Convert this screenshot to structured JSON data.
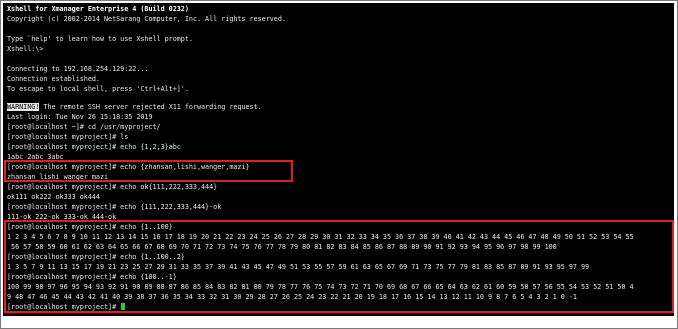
{
  "terminal": {
    "lines": [
      "Xshell for Xmanager Enterprise 4 (Build 0232)",
      "Copyright (c) 2002-2014 NetSarang Computer, Inc. All rights reserved.",
      "",
      "Type `help' to learn how to use Xshell prompt.",
      "Xshell:\\>",
      "",
      "Connecting to 192.168.254.129:22...",
      "Connection established.",
      "To escape to local shell, press 'Ctrl+Alt+]'.",
      "",
      "WARNING!",
      "Last login: Tue Nov 26 15:18:35 2019",
      "[root@localhost ~]# cd /usr/myproject/",
      "[root@localhost myproject]# ls",
      "[root@localhost myproject]# echo {1,2,3}abc",
      "1abc 2abc 3abc",
      "[root@localhost myproject]# echo {zhansan,lishi,wanger,mazi}",
      "zhansan lishi wanger mazi",
      "[root@localhost myproject]# echo ok{111,222,333,444}",
      "ok111 ok222 ok333 ok444",
      "[root@localhost myproject]# echo {111,222,333,444}-ok",
      "111-ok 222-ok 333-ok 444-ok",
      "[root@localhost myproject]# echo {1..100}",
      "1 2 3 4 5 6 7 8 9 10 11 12 13 14 15 16 17 18 19 20 21 22 23 24 25 26 27 28 29 30 31 32 33 34 35 36 37 38 39 40 41 42 43 44 45 46 47 48 49 50 51 52 53 54 55",
      " 56 57 58 59 60 61 62 63 64 65 66 67 68 69 70 71 72 73 74 75 76 77 78 79 80 81 82 83 84 85 86 87 88 89 90 91 92 93 94 95 96 97 98 99 100",
      "[root@localhost myproject]# echo {1..100..2}",
      "1 3 5 7 9 11 13 15 17 19 21 23 25 27 29 31 33 35 37 39 41 43 45 47 49 51 53 55 57 59 61 63 65 67 69 71 73 75 77 79 81 83 85 87 89 91 93 95 97 99",
      "[root@localhost myproject]# echo {100..-1}",
      "100 99 98 97 96 95 94 93 92 91 90 89 88 87 86 85 84 83 82 81 80 79 78 77 76 75 74 73 72 71 70 69 68 67 66 65 64 63 62 61 60 59 58 57 56 55 54 53 52 51 50 4",
      "9 48 47 46 45 44 43 42 41 40 39 38 37 36 35 34 33 32 31 30 29 28 27 26 25 24 23 22 21 20 19 18 17 16 15 14 13 12 11 10 9 8 7 6 5 4 3 2 1 0 -1",
      "[root@localhost myproject]# "
    ],
    "warning_rest": " The remote SSH server rejected X11 forwarding request.",
    "colors": {
      "background": "#000000",
      "foreground": "#e6e6e6",
      "cursor": "#22d322",
      "highlight_box": "#e02020"
    }
  }
}
